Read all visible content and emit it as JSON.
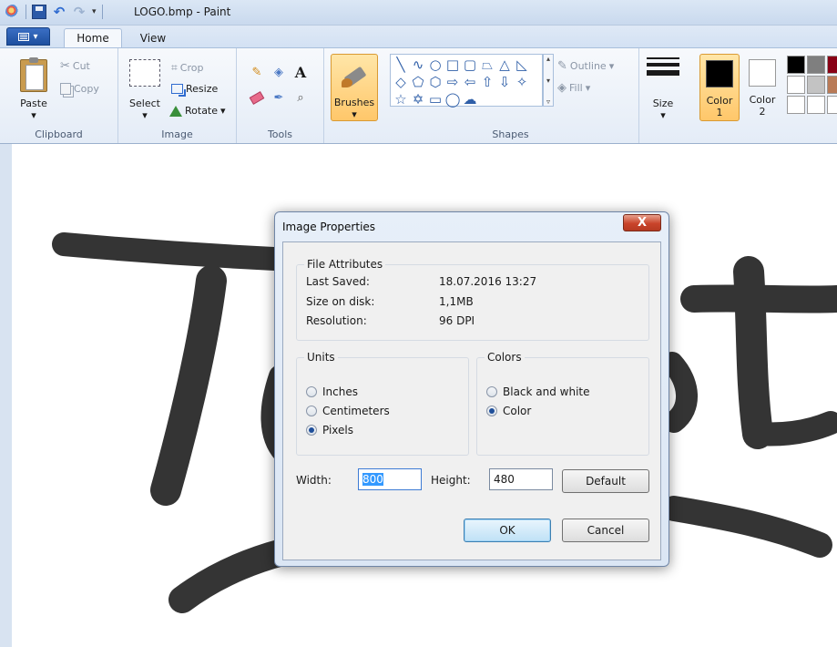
{
  "window": {
    "title": "LOGO.bmp - Paint"
  },
  "ribbon": {
    "tabs": [
      {
        "label": "Home"
      },
      {
        "label": "View"
      }
    ],
    "clipboard": {
      "label": "Clipboard",
      "paste": "Paste",
      "cut": "Cut",
      "copy": "Copy"
    },
    "image": {
      "label": "Image",
      "select": "Select",
      "crop": "Crop",
      "resize": "Resize",
      "rotate": "Rotate"
    },
    "tools": {
      "label": "Tools"
    },
    "brushes": {
      "label": "Brushes"
    },
    "shapes": {
      "label": "Shapes",
      "outline": "Outline",
      "fill": "Fill"
    },
    "size": {
      "label": "Size"
    },
    "colors": {
      "color1": "Color\n1",
      "color2": "Color\n2",
      "color1_value": "#000000",
      "color2_value": "#ffffff",
      "palette": [
        "#000000",
        "#7f7f7f",
        "#880015",
        "#ffffff",
        "#c3c3c3",
        "#b97a57",
        "#ffffff",
        "#ffffff",
        "#ffffff"
      ]
    }
  },
  "dialog": {
    "title": "Image Properties",
    "close_label": "X",
    "file_attributes": {
      "legend": "File Attributes",
      "rows": [
        {
          "label": "Last Saved:",
          "value": "18.07.2016 13:27"
        },
        {
          "label": "Size on disk:",
          "value": "1,1MB"
        },
        {
          "label": "Resolution:",
          "value": "96 DPI"
        }
      ]
    },
    "units": {
      "legend": "Units",
      "options": [
        {
          "label": "Inches",
          "selected": false
        },
        {
          "label": "Centimeters",
          "selected": false
        },
        {
          "label": "Pixels",
          "selected": true
        }
      ]
    },
    "colors": {
      "legend": "Colors",
      "options": [
        {
          "label": "Black and white",
          "selected": false
        },
        {
          "label": "Color",
          "selected": true
        }
      ]
    },
    "width_label": "Width:",
    "width_value": "800",
    "height_label": "Height:",
    "height_value": "480",
    "default_label": "Default",
    "ok_label": "OK",
    "cancel_label": "Cancel"
  }
}
